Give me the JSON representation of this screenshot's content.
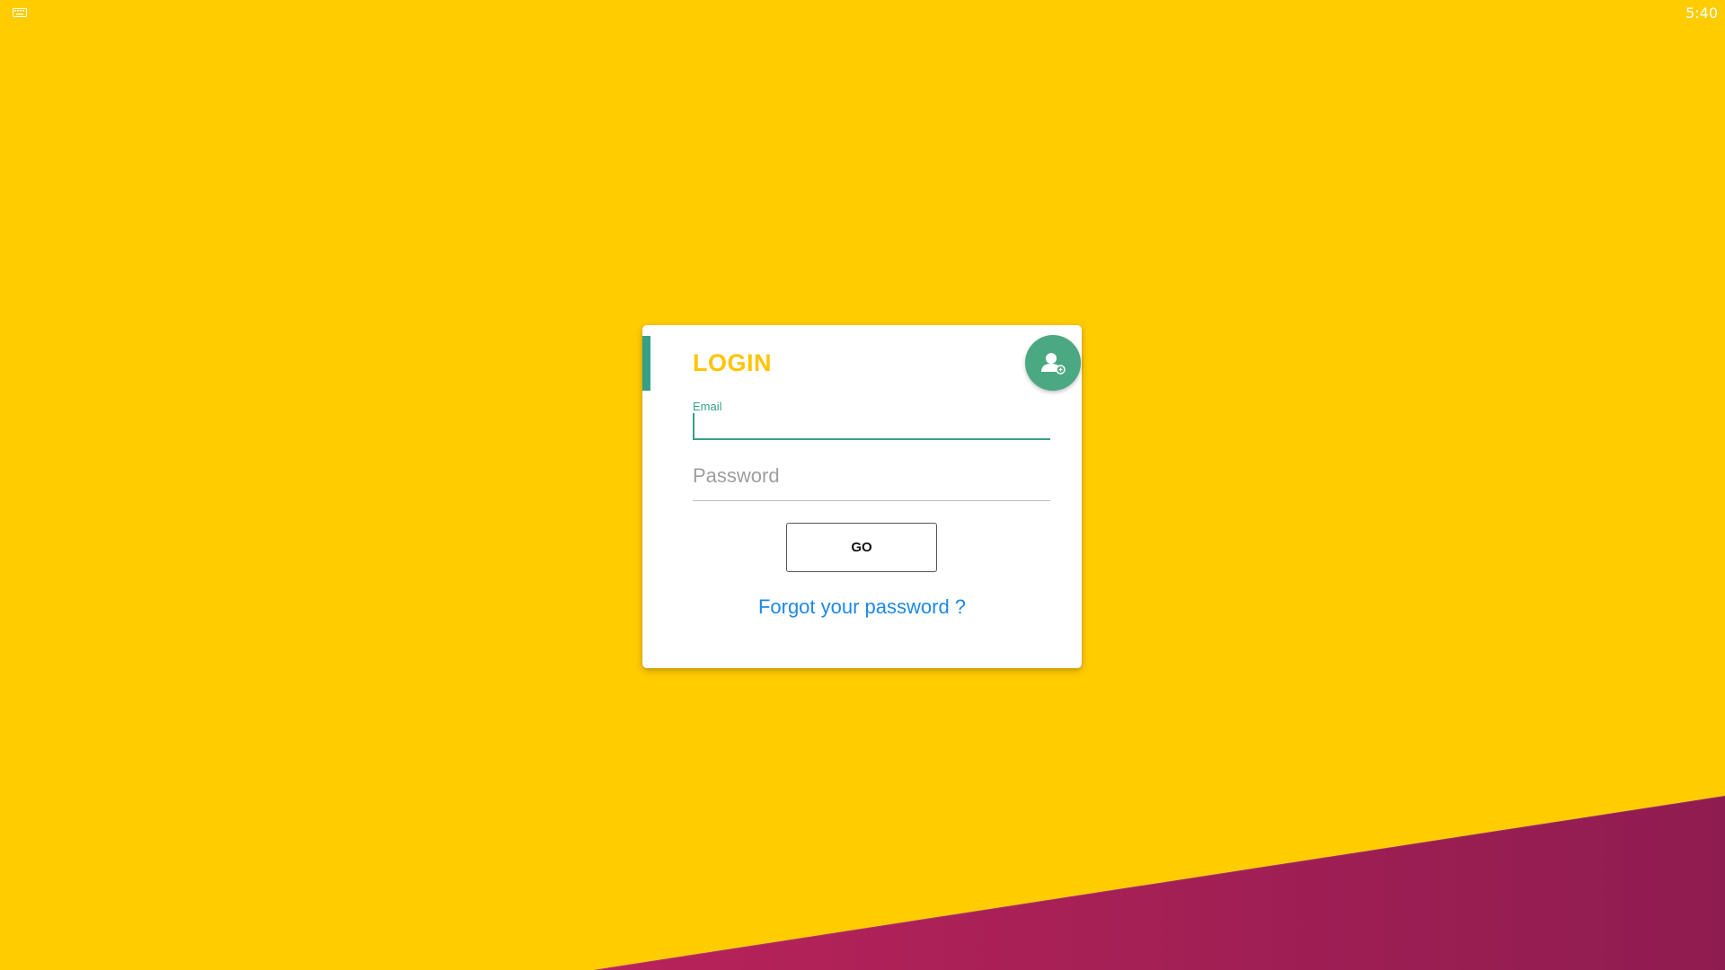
{
  "status_bar": {
    "time": "5:40",
    "keyboard_icon": "keyboard-icon"
  },
  "login_card": {
    "title": "LOGIN",
    "register_icon": "add-user-icon",
    "email": {
      "label": "Email",
      "value": ""
    },
    "password": {
      "placeholder": "Password",
      "value": ""
    },
    "go_label": "GO",
    "forgot_label": "Forgot your password ?"
  },
  "colors": {
    "background": "#ffcc00",
    "wave": "#9b1e52",
    "accent": "#36a086",
    "fab": "#4aa882",
    "title": "#ffc400",
    "link": "#1e88e5"
  }
}
